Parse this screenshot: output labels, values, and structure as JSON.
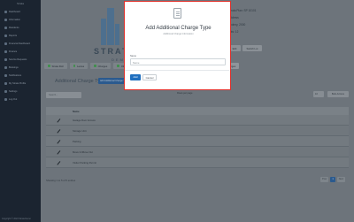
{
  "sidebar": {
    "top_label": "Strata",
    "items": [
      {
        "label": "Dashboard"
      },
      {
        "label": "Information"
      },
      {
        "label": "Residents"
      },
      {
        "label": "Reports"
      },
      {
        "label": "Financial Dashboard"
      },
      {
        "label": "Finance"
      },
      {
        "label": "Service Requests"
      },
      {
        "label": "Bookings"
      },
      {
        "label": "Notifications"
      },
      {
        "label": "My Strata Profile"
      },
      {
        "label": "Settings"
      },
      {
        "label": "Log Out"
      }
    ],
    "footer": "Copyright © 2024 Strata Demo"
  },
  "logo": {
    "text": "STRATA",
    "sub": "DEMO CO"
  },
  "info_lines": [
    "Strata Plan: SP 10101",
    "Address",
    "Sydney, 2000",
    "Lots: 12"
  ],
  "buttons": {
    "edit": "Edit",
    "switch": "Switch Lot"
  },
  "tabs": [
    {
      "label": "Strata Roll"
    },
    {
      "label": "Levies"
    },
    {
      "label": "Charges"
    },
    {
      "label": "Other Charges"
    },
    {
      "label": "Additional Charges"
    }
  ],
  "section": {
    "title": "Additional Charge Types",
    "add_button": "Add Additional Charge Type"
  },
  "controls": {
    "search_placeholder": "Search...",
    "row_count": "Rows per page",
    "page_size": "10",
    "export": "Bulk Actions"
  },
  "table": {
    "header": "Name",
    "rows": [
      {
        "name": "Garage Door Access"
      },
      {
        "name": "Storage Unit"
      },
      {
        "name": "Parking"
      },
      {
        "name": "Move In/Move Out"
      },
      {
        "name": "Visitor Parking Permit"
      }
    ]
  },
  "footer": {
    "showing": "Showing 1 to 5 of 5 entries",
    "pages": [
      "Prev",
      "1",
      "Next"
    ],
    "active_page": "1"
  },
  "modal": {
    "title": "Add Additional Charge Type",
    "subtitle": "Additional Charge Information",
    "field_label": "Name",
    "field_placeholder": "Name",
    "add_label": "Add",
    "cancel_label": "Cancel"
  },
  "colors": {
    "sidebar": "#1b2430",
    "accent": "#2b5a8e",
    "modal_border": "#e0302a",
    "primary_button": "#1f6fbf"
  }
}
